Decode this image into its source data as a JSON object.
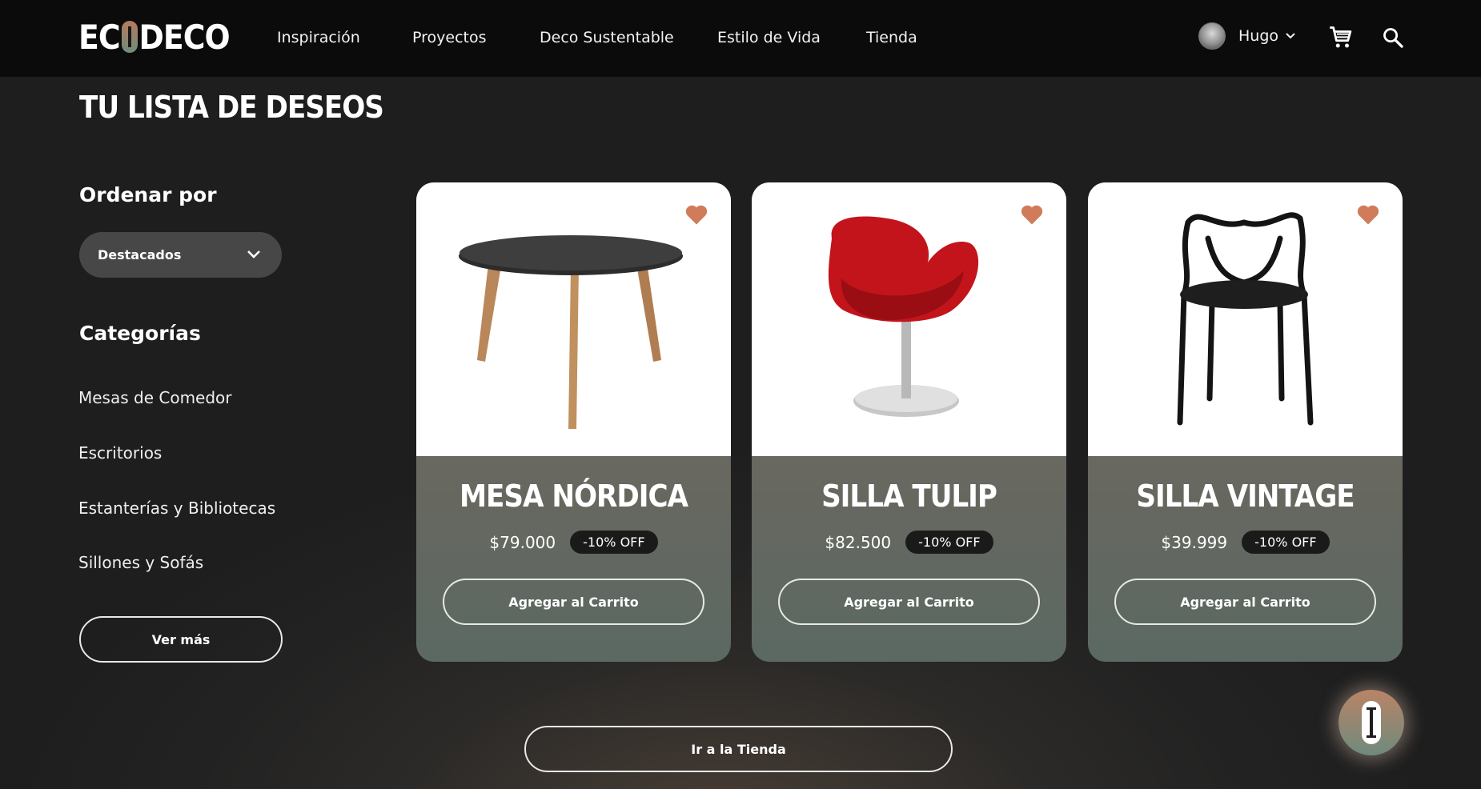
{
  "header": {
    "logo_left": "EC",
    "logo_right": "DECO",
    "nav": [
      "Inspiración",
      "Proyectos",
      "Deco Sustentable",
      "Estilo de Vida",
      "Tienda"
    ],
    "user_name": "Hugo",
    "icons": [
      "cart-icon",
      "search-icon",
      "chevron-down-icon"
    ]
  },
  "page_title": "TU LISTA DE DESEOS",
  "sidebar": {
    "sort_title": "Ordenar por",
    "sort_selected": "Destacados",
    "categories_title": "Categorías",
    "categories": [
      "Mesas de Comedor",
      "Escritorios",
      "Estanterías y Bibliotecas",
      "Sillones y Sofás"
    ],
    "more_label": "Ver más"
  },
  "products": [
    {
      "name": "MESA NÓRDICA",
      "price": "$79.000",
      "discount": "-10% OFF",
      "button": "Agregar al Carrito",
      "image": "round-table"
    },
    {
      "name": "SILLA TULIP",
      "price": "$82.500",
      "discount": "-10% OFF",
      "button": "Agregar al Carrito",
      "image": "red-tulip-chair"
    },
    {
      "name": "SILLA VINTAGE",
      "price": "$39.999",
      "discount": "-10% OFF",
      "button": "Agregar al Carrito",
      "image": "black-vintage-chair"
    }
  ],
  "store_button": "Ir a la Tienda",
  "colors": {
    "accent_heart": "#d07c5a",
    "card_top": "#7d6659",
    "card_bottom": "#5b6962",
    "header_bg": "#0b0b0b"
  }
}
